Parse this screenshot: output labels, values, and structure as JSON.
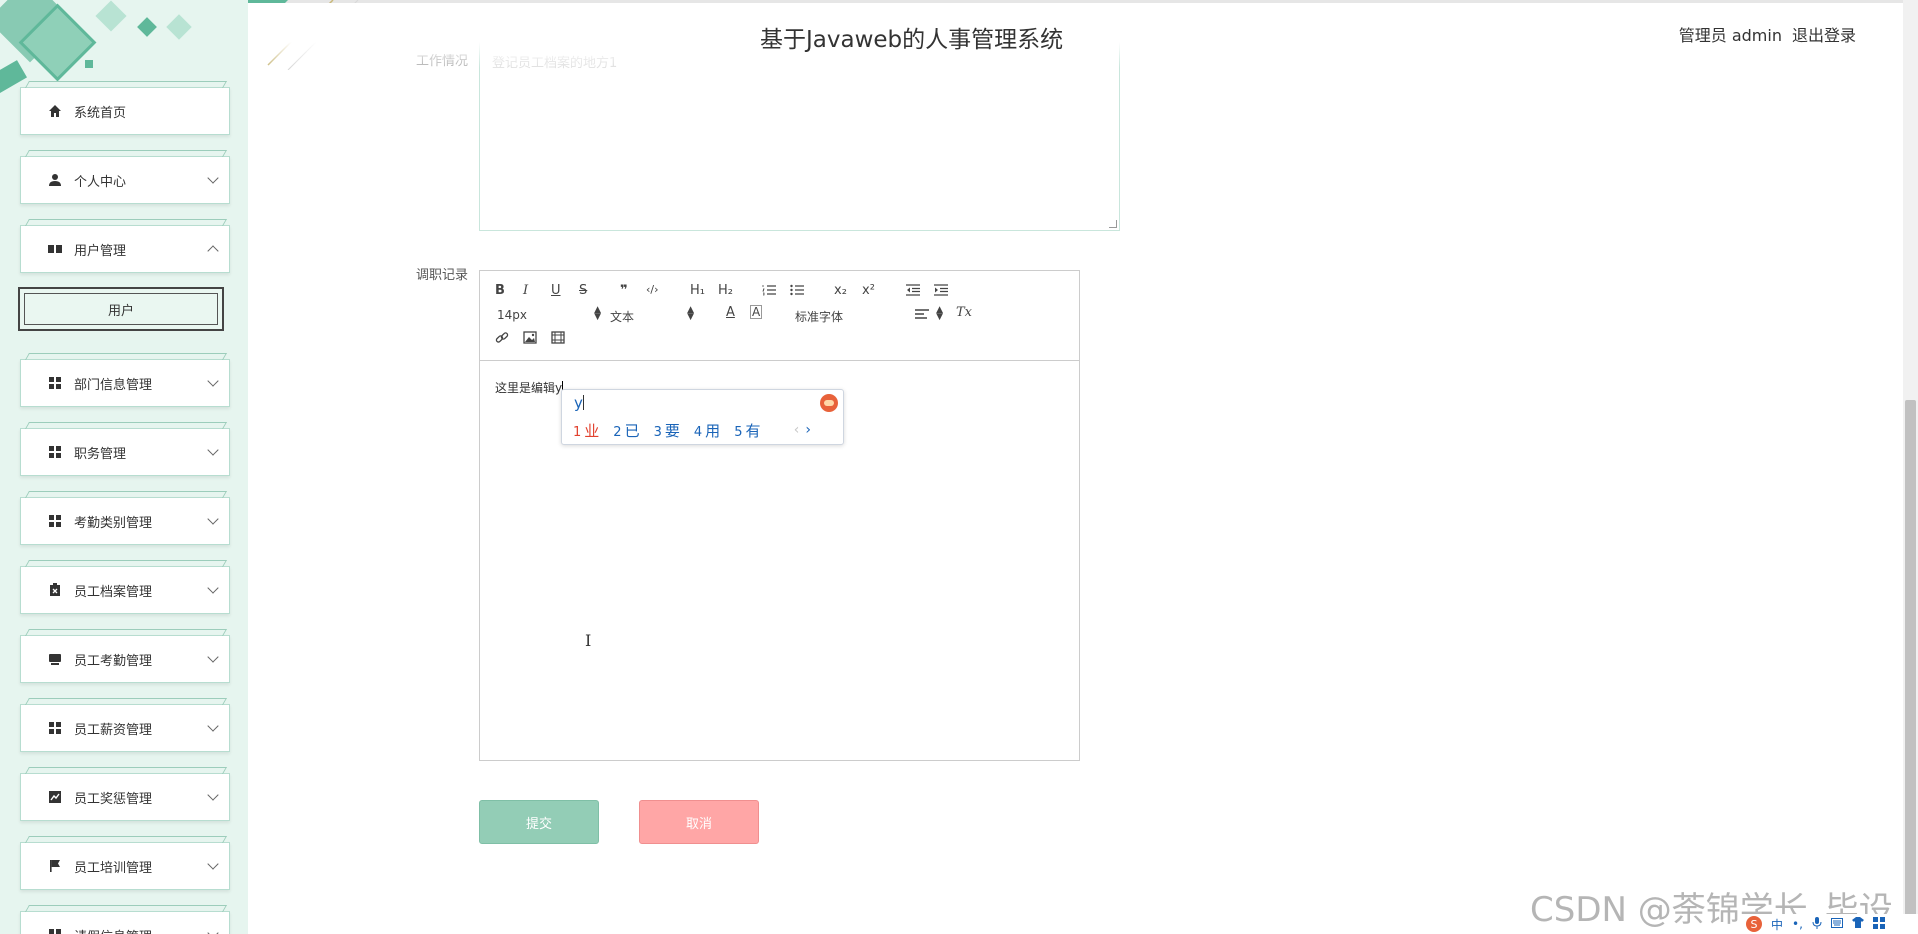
{
  "header": {
    "title": "基于Javaweb的人事管理系统",
    "user": "管理员 admin",
    "logout": "退出登录"
  },
  "sidebar": {
    "items": [
      {
        "label": "系统首页",
        "icon": "home-icon"
      },
      {
        "label": "个人中心",
        "icon": "person-icon"
      },
      {
        "label": "用户管理",
        "icon": "users-icon",
        "expanded": true
      },
      {
        "label": "部门信息管理",
        "icon": "grid-icon"
      },
      {
        "label": "职务管理",
        "icon": "grid-icon"
      },
      {
        "label": "考勤类别管理",
        "icon": "grid-icon"
      },
      {
        "label": "员工档案管理",
        "icon": "clipboard-icon"
      },
      {
        "label": "员工考勤管理",
        "icon": "monitor-icon"
      },
      {
        "label": "员工薪资管理",
        "icon": "grid-icon"
      },
      {
        "label": "员工奖惩管理",
        "icon": "chart-icon"
      },
      {
        "label": "员工培训管理",
        "icon": "flag-icon"
      },
      {
        "label": "请假信息管理",
        "icon": "grid-icon"
      }
    ],
    "sub_item": "用户"
  },
  "form": {
    "work_label": "工作情况",
    "work_placeholder": "登记员工档案的地方1",
    "record_label": "调职记录",
    "editor_content": "这里是编辑y",
    "font_size": "14px",
    "text_style": "文本",
    "font_family": "标准字体",
    "submit": "提交",
    "cancel": "取消"
  },
  "toolbar": {
    "bold": "B",
    "italic": "I",
    "underline": "U",
    "strike": "S",
    "quote": "❞",
    "code": "‹/›",
    "h1": "H₁",
    "h2": "H₂",
    "sub": "x₂",
    "sup": "x²",
    "clear": "Tx"
  },
  "ime": {
    "input": "y",
    "candidates": [
      {
        "num": "1",
        "char": "业"
      },
      {
        "num": "2",
        "char": "已"
      },
      {
        "num": "3",
        "char": "要"
      },
      {
        "num": "4",
        "char": "用"
      },
      {
        "num": "5",
        "char": "有"
      }
    ],
    "prev": "‹",
    "next": "›"
  },
  "watermark": "CSDN @荼锦学长_毕设",
  "tray": {
    "lang": "中",
    "punct": "•,"
  },
  "colors": {
    "accent": "#5fb89a",
    "sidebar_bg": "#e6f5ef",
    "submit": "#93cdb6",
    "cancel": "#ffa6a6"
  }
}
